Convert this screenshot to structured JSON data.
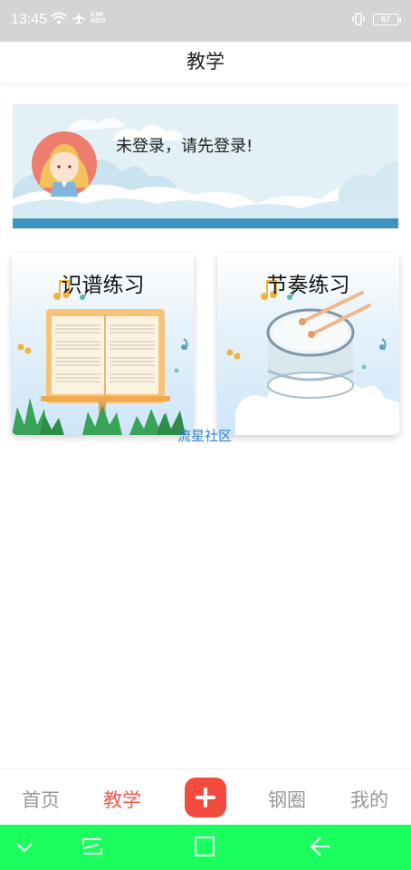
{
  "status_bar": {
    "time": "13:45",
    "net_speed_value": "5.99",
    "net_speed_unit": "KB/S",
    "battery": "67"
  },
  "header": {
    "title": "教学"
  },
  "banner": {
    "login_prompt": "未登录，请先登录!"
  },
  "cards": [
    {
      "title": "识谱练习"
    },
    {
      "title": "节奏练习"
    }
  ],
  "watermark": "流星社区",
  "bottom_nav": {
    "items": [
      {
        "label": "首页",
        "active": false
      },
      {
        "label": "教学",
        "active": true
      },
      {
        "label": "钢圈",
        "active": false
      },
      {
        "label": "我的",
        "active": false
      }
    ],
    "add_icon": "plus-icon"
  },
  "system_nav": {
    "icons": [
      "chevron-down-icon",
      "recent-apps-icon",
      "home-square-icon",
      "back-arrow-icon"
    ],
    "color": "#1aff5e"
  },
  "colors": {
    "accent": "#f25b4c",
    "link": "#2c7fd3"
  }
}
